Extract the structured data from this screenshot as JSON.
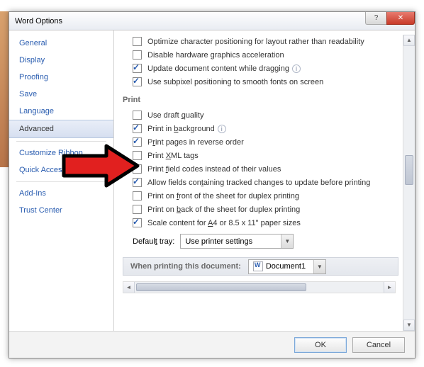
{
  "dialog_title": "Word Options",
  "win": {
    "help": "?",
    "close": "✕"
  },
  "sidebar": {
    "items": [
      {
        "label": "General"
      },
      {
        "label": "Display"
      },
      {
        "label": "Proofing"
      },
      {
        "label": "Save"
      },
      {
        "label": "Language"
      },
      {
        "label": "Advanced",
        "selected": true
      }
    ],
    "items2": [
      {
        "label": "Customize Ribbon"
      },
      {
        "label": "Quick Access Toolbar"
      }
    ],
    "items3": [
      {
        "label": "Add-Ins"
      },
      {
        "label": "Trust Center"
      }
    ]
  },
  "top_opts": [
    {
      "label": "Optimize character positioning for layout rather than readability",
      "checked": false,
      "info": false
    },
    {
      "label": "Disable hardware graphics acceleration",
      "checked": false,
      "info": false
    },
    {
      "label": "Update document content while dragging",
      "checked": true,
      "info": true
    },
    {
      "label": "Use subpixel positioning to smooth fonts on screen",
      "checked": true,
      "info": false
    }
  ],
  "print_header": "Print",
  "print_opts": [
    {
      "label": "Use draft quality",
      "checked": false,
      "info": false,
      "ukey": "q"
    },
    {
      "label": "Print in background",
      "checked": true,
      "info": true,
      "ukey": "b"
    },
    {
      "label": "Print pages in reverse order",
      "checked": true,
      "info": false,
      "ukey": "r"
    },
    {
      "label": "Print XML tags",
      "checked": false,
      "info": false,
      "ukey": "X"
    },
    {
      "label": "Print field codes instead of their values",
      "checked": false,
      "info": false,
      "ukey": "f"
    },
    {
      "label": "Allow fields containing tracked changes to update before printing",
      "checked": true,
      "info": false,
      "ukey": "t"
    },
    {
      "label": "Print on front of the sheet for duplex printing",
      "checked": false,
      "info": false,
      "ukey": "f"
    },
    {
      "label": "Print on back of the sheet for duplex printing",
      "checked": false,
      "info": false,
      "ukey": "b"
    },
    {
      "label": "Scale content for A4 or 8.5 x 11\" paper sizes",
      "checked": true,
      "info": false,
      "ukey": "A"
    }
  ],
  "default_tray": {
    "label": "Default tray:",
    "value": "Use printer settings",
    "ukey": "t"
  },
  "doc_bar": {
    "label": "When printing this document:",
    "value": "Document1"
  },
  "buttons": {
    "ok": "OK",
    "cancel": "Cancel"
  }
}
